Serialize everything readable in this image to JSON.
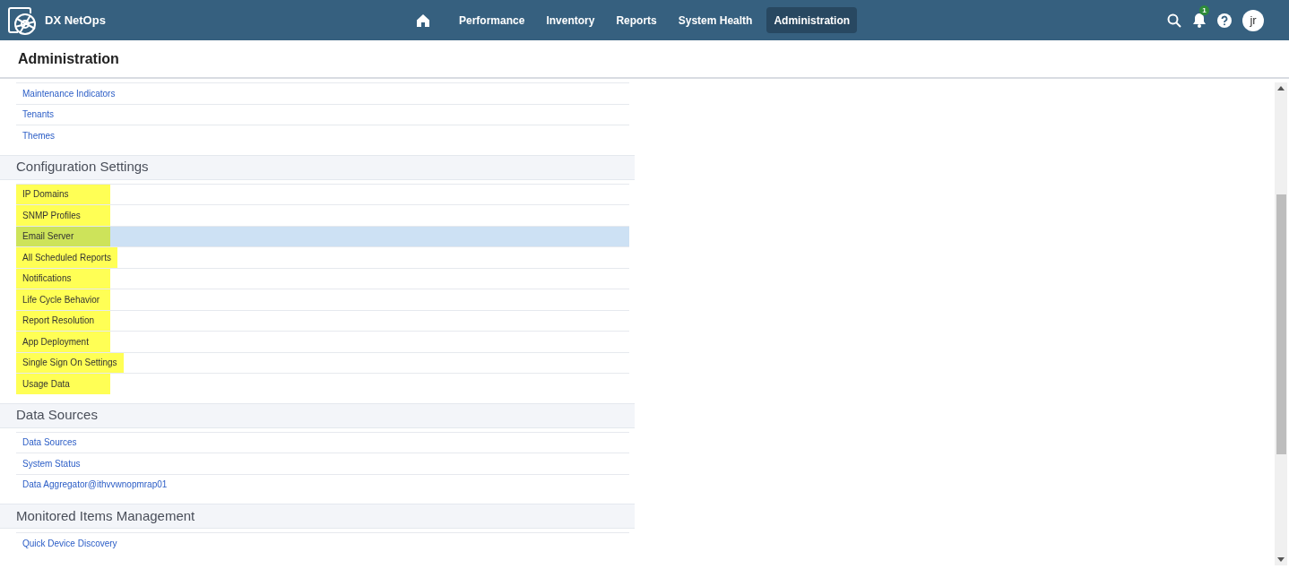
{
  "app": {
    "name": "DX NetOps"
  },
  "nav": [
    {
      "label": "Performance",
      "selected": false
    },
    {
      "label": "Inventory",
      "selected": false
    },
    {
      "label": "Reports",
      "selected": false
    },
    {
      "label": "System Health",
      "selected": false
    },
    {
      "label": "Administration",
      "selected": true
    }
  ],
  "notifications": {
    "count": "1"
  },
  "user": {
    "initials": "jr"
  },
  "page_title": "Administration",
  "sections": [
    {
      "items": [
        {
          "label": "Maintenance Indicators",
          "selected": false,
          "highlighted": false
        },
        {
          "label": "Tenants",
          "selected": false,
          "highlighted": false
        },
        {
          "label": "Themes",
          "selected": false,
          "highlighted": false
        }
      ]
    },
    {
      "title": "Configuration Settings",
      "items": [
        {
          "label": "IP Domains",
          "selected": false,
          "highlighted": true
        },
        {
          "label": "SNMP Profiles",
          "selected": false,
          "highlighted": true
        },
        {
          "label": "Email Server",
          "selected": true,
          "highlighted": true
        },
        {
          "label": "All Scheduled Reports",
          "selected": false,
          "highlighted": true
        },
        {
          "label": "Notifications",
          "selected": false,
          "highlighted": true
        },
        {
          "label": "Life Cycle Behavior",
          "selected": false,
          "highlighted": true
        },
        {
          "label": "Report Resolution",
          "selected": false,
          "highlighted": true
        },
        {
          "label": "App Deployment",
          "selected": false,
          "highlighted": true
        },
        {
          "label": "Single Sign On Settings",
          "selected": false,
          "highlighted": true
        },
        {
          "label": "Usage Data",
          "selected": false,
          "highlighted": true
        }
      ]
    },
    {
      "title": "Data Sources",
      "items": [
        {
          "label": "Data Sources",
          "selected": false,
          "highlighted": false
        },
        {
          "label": "System Status",
          "selected": false,
          "highlighted": false
        },
        {
          "label": "Data Aggregator@ithvvwnopmrap01",
          "selected": false,
          "highlighted": false
        }
      ]
    },
    {
      "title": "Monitored Items Management",
      "items": [
        {
          "label": "Quick Device Discovery",
          "selected": false,
          "highlighted": false
        }
      ]
    }
  ]
}
